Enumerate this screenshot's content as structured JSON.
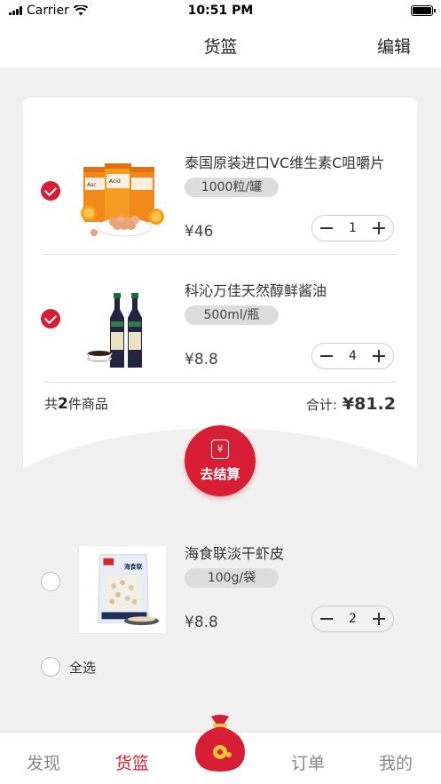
{
  "status_bar": {
    "carrier": "Carrier",
    "time": "10:51 PM"
  },
  "nav": {
    "title": "货篮",
    "edit_label": "编辑"
  },
  "cart": {
    "items": [
      {
        "name": "泰国原装进口VC维生素C咀嚼片",
        "spec": "1000粒/罐",
        "price": "¥46",
        "qty": "1",
        "selected": true
      },
      {
        "name": "科沁万佳天然醇鲜酱油",
        "spec": "500ml/瓶",
        "price": "¥8.8",
        "qty": "4",
        "selected": true
      },
      {
        "name": "海食联淡干虾皮",
        "spec": "100g/袋",
        "price": "¥8.8",
        "qty": "2",
        "selected": false
      }
    ],
    "summary": {
      "count_prefix": "共",
      "count": "2",
      "count_suffix": "件商品",
      "total_label": "合计:",
      "total": "¥81.2"
    },
    "checkout": {
      "label": "去结算",
      "icon_glyph": "¥"
    },
    "select_all_label": "全选"
  },
  "tabs": [
    {
      "label": "发现",
      "active": false
    },
    {
      "label": "货篮",
      "active": true
    },
    {
      "label": "订单",
      "active": false
    },
    {
      "label": "我的",
      "active": false
    }
  ],
  "colors": {
    "accent": "#d81e34",
    "background": "#f0f0f0"
  }
}
